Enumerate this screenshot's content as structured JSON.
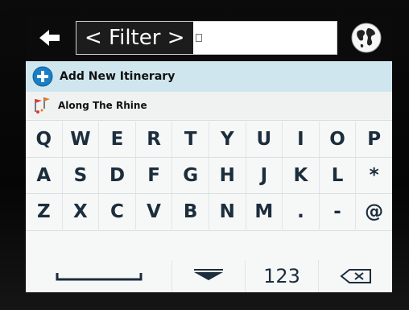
{
  "filter": {
    "text": "< Filter >"
  },
  "list": {
    "add_label": "Add New Itinerary",
    "item_label": "Along The Rhine"
  },
  "keyboard": {
    "row1": [
      "Q",
      "W",
      "E",
      "R",
      "T",
      "Y",
      "U",
      "I",
      "O",
      "P"
    ],
    "row2": [
      "A",
      "S",
      "D",
      "F",
      "G",
      "H",
      "J",
      "K",
      "L",
      "*"
    ],
    "row3": [
      "Z",
      "X",
      "C",
      "V",
      "B",
      "N",
      "M",
      ".",
      "-",
      "@"
    ],
    "numbers_label": "123"
  },
  "icons": {
    "back": "left-arrow-icon",
    "globe": "globe-icon",
    "add": "plus-circle-icon",
    "itinerary": "route-flags-icon",
    "space": "space-bar-icon",
    "hide": "hide-keyboard-icon",
    "backspace": "backspace-icon"
  },
  "colors": {
    "topbar": "#0b0b0b",
    "add_row": "#cfe6ef",
    "key_text": "#1c2d3c",
    "add_icon": "#1a7fc4"
  }
}
